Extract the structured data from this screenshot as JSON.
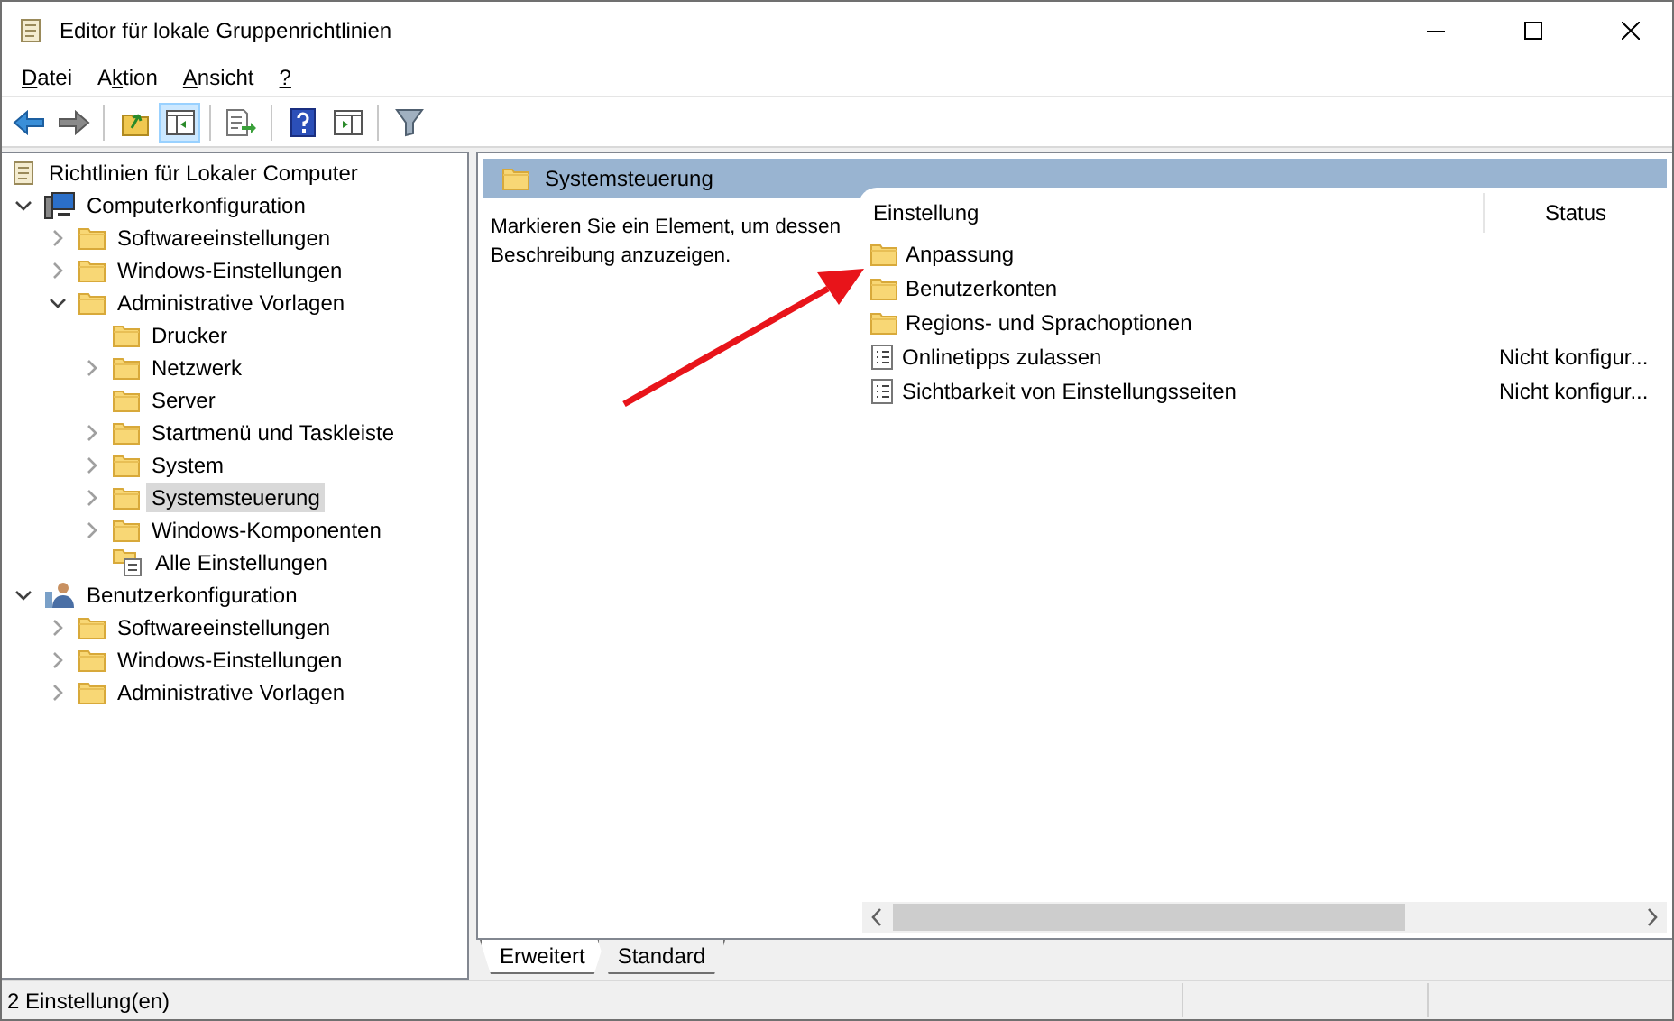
{
  "window": {
    "title": "Editor für lokale Gruppenrichtlinien"
  },
  "menu": [
    {
      "key": "D",
      "post": "atei"
    },
    {
      "pre": "A",
      "key": "k",
      "post": "tion"
    },
    {
      "key": "A",
      "post": "nsicht"
    },
    {
      "key": "?"
    }
  ],
  "toolbar": [
    {
      "kind": "back",
      "pressed": false
    },
    {
      "kind": "forward",
      "pressed": false
    },
    {
      "kind": "sep"
    },
    {
      "kind": "up",
      "pressed": false
    },
    {
      "kind": "tree",
      "pressed": true
    },
    {
      "kind": "sep"
    },
    {
      "kind": "export",
      "pressed": false
    },
    {
      "kind": "sep"
    },
    {
      "kind": "help",
      "pressed": false
    },
    {
      "kind": "pane",
      "pressed": false
    },
    {
      "kind": "sep"
    },
    {
      "kind": "filter",
      "pressed": false
    }
  ],
  "tree": [
    {
      "label": "Richtlinien für Lokaler Computer",
      "kind": "policy",
      "selected": false,
      "children": [
        {
          "label": "Computerkonfiguration",
          "kind": "computer",
          "expanded": true,
          "selected": false,
          "children": [
            {
              "label": "Softwareeinstellungen",
              "kind": "folder",
              "expanded": false,
              "selected": false
            },
            {
              "label": "Windows-Einstellungen",
              "kind": "folder",
              "expanded": false,
              "selected": false
            },
            {
              "label": "Administrative Vorlagen",
              "kind": "folder",
              "expanded": true,
              "selected": false,
              "children": [
                {
                  "label": "Drucker",
                  "kind": "folder",
                  "selected": false
                },
                {
                  "label": "Netzwerk",
                  "kind": "folder",
                  "expanded": false,
                  "selected": false
                },
                {
                  "label": "Server",
                  "kind": "folder",
                  "selected": false
                },
                {
                  "label": "Startmenü und Taskleiste",
                  "kind": "folder",
                  "expanded": false,
                  "selected": false
                },
                {
                  "label": "System",
                  "kind": "folder",
                  "expanded": false,
                  "selected": false
                },
                {
                  "label": "Systemsteuerung",
                  "kind": "folder",
                  "expanded": false,
                  "selected": true
                },
                {
                  "label": "Windows-Komponenten",
                  "kind": "folder",
                  "expanded": false,
                  "selected": false
                },
                {
                  "label": "Alle Einstellungen",
                  "kind": "settings",
                  "selected": false
                }
              ]
            }
          ]
        },
        {
          "label": "Benutzerkonfiguration",
          "kind": "user",
          "expanded": true,
          "selected": false,
          "children": [
            {
              "label": "Softwareeinstellungen",
              "kind": "folder",
              "expanded": false,
              "selected": false
            },
            {
              "label": "Windows-Einstellungen",
              "kind": "folder",
              "expanded": false,
              "selected": false
            },
            {
              "label": "Administrative Vorlagen",
              "kind": "folder",
              "expanded": false,
              "selected": false
            }
          ]
        }
      ]
    }
  ],
  "details": {
    "header": "Systemsteuerung",
    "description": "Markieren Sie ein Element, um dessen Beschreibung anzuzeigen.",
    "columns": [
      "Einstellung",
      "Status"
    ],
    "rows": [
      {
        "kind": "folder",
        "name": "Anpassung"
      },
      {
        "kind": "folder",
        "name": "Benutzerkonten"
      },
      {
        "kind": "folder",
        "name": "Regions- und Sprachoptionen"
      },
      {
        "kind": "setting",
        "name": "Onlinetipps zulassen",
        "status": "Nicht konfigur..."
      },
      {
        "kind": "setting",
        "name": "Sichtbarkeit von Einstellungsseiten",
        "status": "Nicht konfigur..."
      }
    ]
  },
  "view_tabs": [
    {
      "label": "Erweitert",
      "selected": true
    },
    {
      "label": "Standard",
      "selected": false
    }
  ],
  "status_bar": {
    "text": "2 Einstellung(en)"
  }
}
